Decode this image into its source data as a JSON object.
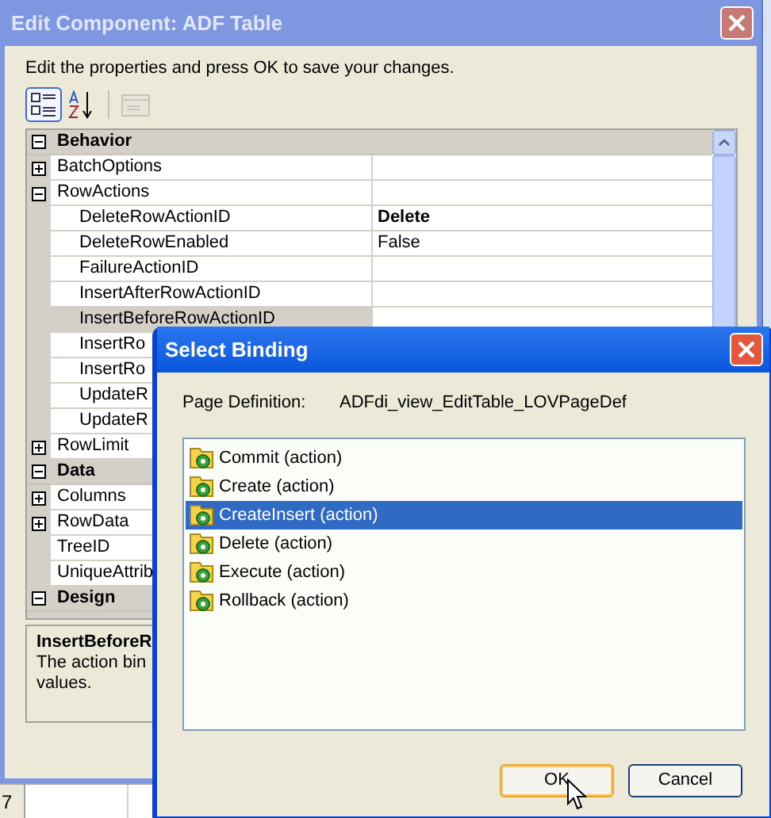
{
  "main_window": {
    "title": "Edit Component: ADF Table",
    "instructions": "Edit the properties and press OK to save your changes.",
    "toolbar": [
      {
        "kind": "categorized",
        "selected": true,
        "disabled": false
      },
      {
        "kind": "alphabetical",
        "selected": false,
        "disabled": false
      },
      {
        "kind": "pages",
        "selected": false,
        "disabled": true
      }
    ],
    "property_grid": [
      {
        "kind": "category",
        "label": "Behavior",
        "expanded": true,
        "children": [
          {
            "kind": "property",
            "name": "BatchOptions",
            "expanded": false,
            "selected": false
          },
          {
            "kind": "property",
            "name": "RowActions",
            "expanded": true,
            "selected": false,
            "children": [
              {
                "kind": "property",
                "name": "DeleteRowActionID",
                "value": "Delete",
                "modified": true,
                "selected": false
              },
              {
                "kind": "property",
                "name": "DeleteRowEnabled",
                "value": "False",
                "modified": false,
                "selected": false
              },
              {
                "kind": "property",
                "name": "FailureActionID",
                "selected": false
              },
              {
                "kind": "property",
                "name": "InsertAfterRowActionID",
                "selected": false
              },
              {
                "kind": "property",
                "name": "InsertBeforeRowActionID",
                "selected": true
              },
              {
                "kind": "property",
                "name": "InsertRo",
                "selected": false
              },
              {
                "kind": "property",
                "name": "InsertRo",
                "selected": false
              },
              {
                "kind": "property",
                "name": "UpdateR",
                "selected": false
              },
              {
                "kind": "property",
                "name": "UpdateR",
                "selected": false
              }
            ]
          },
          {
            "kind": "property",
            "name": "RowLimit",
            "expanded": false,
            "selected": false
          }
        ]
      },
      {
        "kind": "category",
        "label": "Data",
        "expanded": true,
        "children": [
          {
            "kind": "property",
            "name": "Columns",
            "expanded": false,
            "selected": false
          },
          {
            "kind": "property",
            "name": "RowData",
            "expanded": false,
            "selected": false
          },
          {
            "kind": "property",
            "name": "TreeID",
            "selected": false
          },
          {
            "kind": "property",
            "name": "UniqueAttrib",
            "selected": false
          }
        ]
      },
      {
        "kind": "category",
        "label": "Design",
        "expanded": true
      }
    ],
    "description": {
      "title": "InsertBeforeR",
      "lines": [
        "The action bin",
        "values."
      ]
    }
  },
  "background_sheet": {
    "row_number": "7"
  },
  "dialog": {
    "title": "Select Binding",
    "page_definition_label": "Page Definition:",
    "page_definition": "ADFdi_view_EditTable_LOVPageDef",
    "bindings": [
      {
        "label": "Commit (action)",
        "selected": false
      },
      {
        "label": "Create (action)",
        "selected": false
      },
      {
        "label": "CreateInsert (action)",
        "selected": true
      },
      {
        "label": "Delete (action)",
        "selected": false
      },
      {
        "label": "Execute (action)",
        "selected": false
      },
      {
        "label": "Rollback (action)",
        "selected": false
      }
    ],
    "buttons": [
      {
        "label": "OK",
        "default": true
      },
      {
        "label": "Cancel",
        "default": false
      }
    ]
  }
}
